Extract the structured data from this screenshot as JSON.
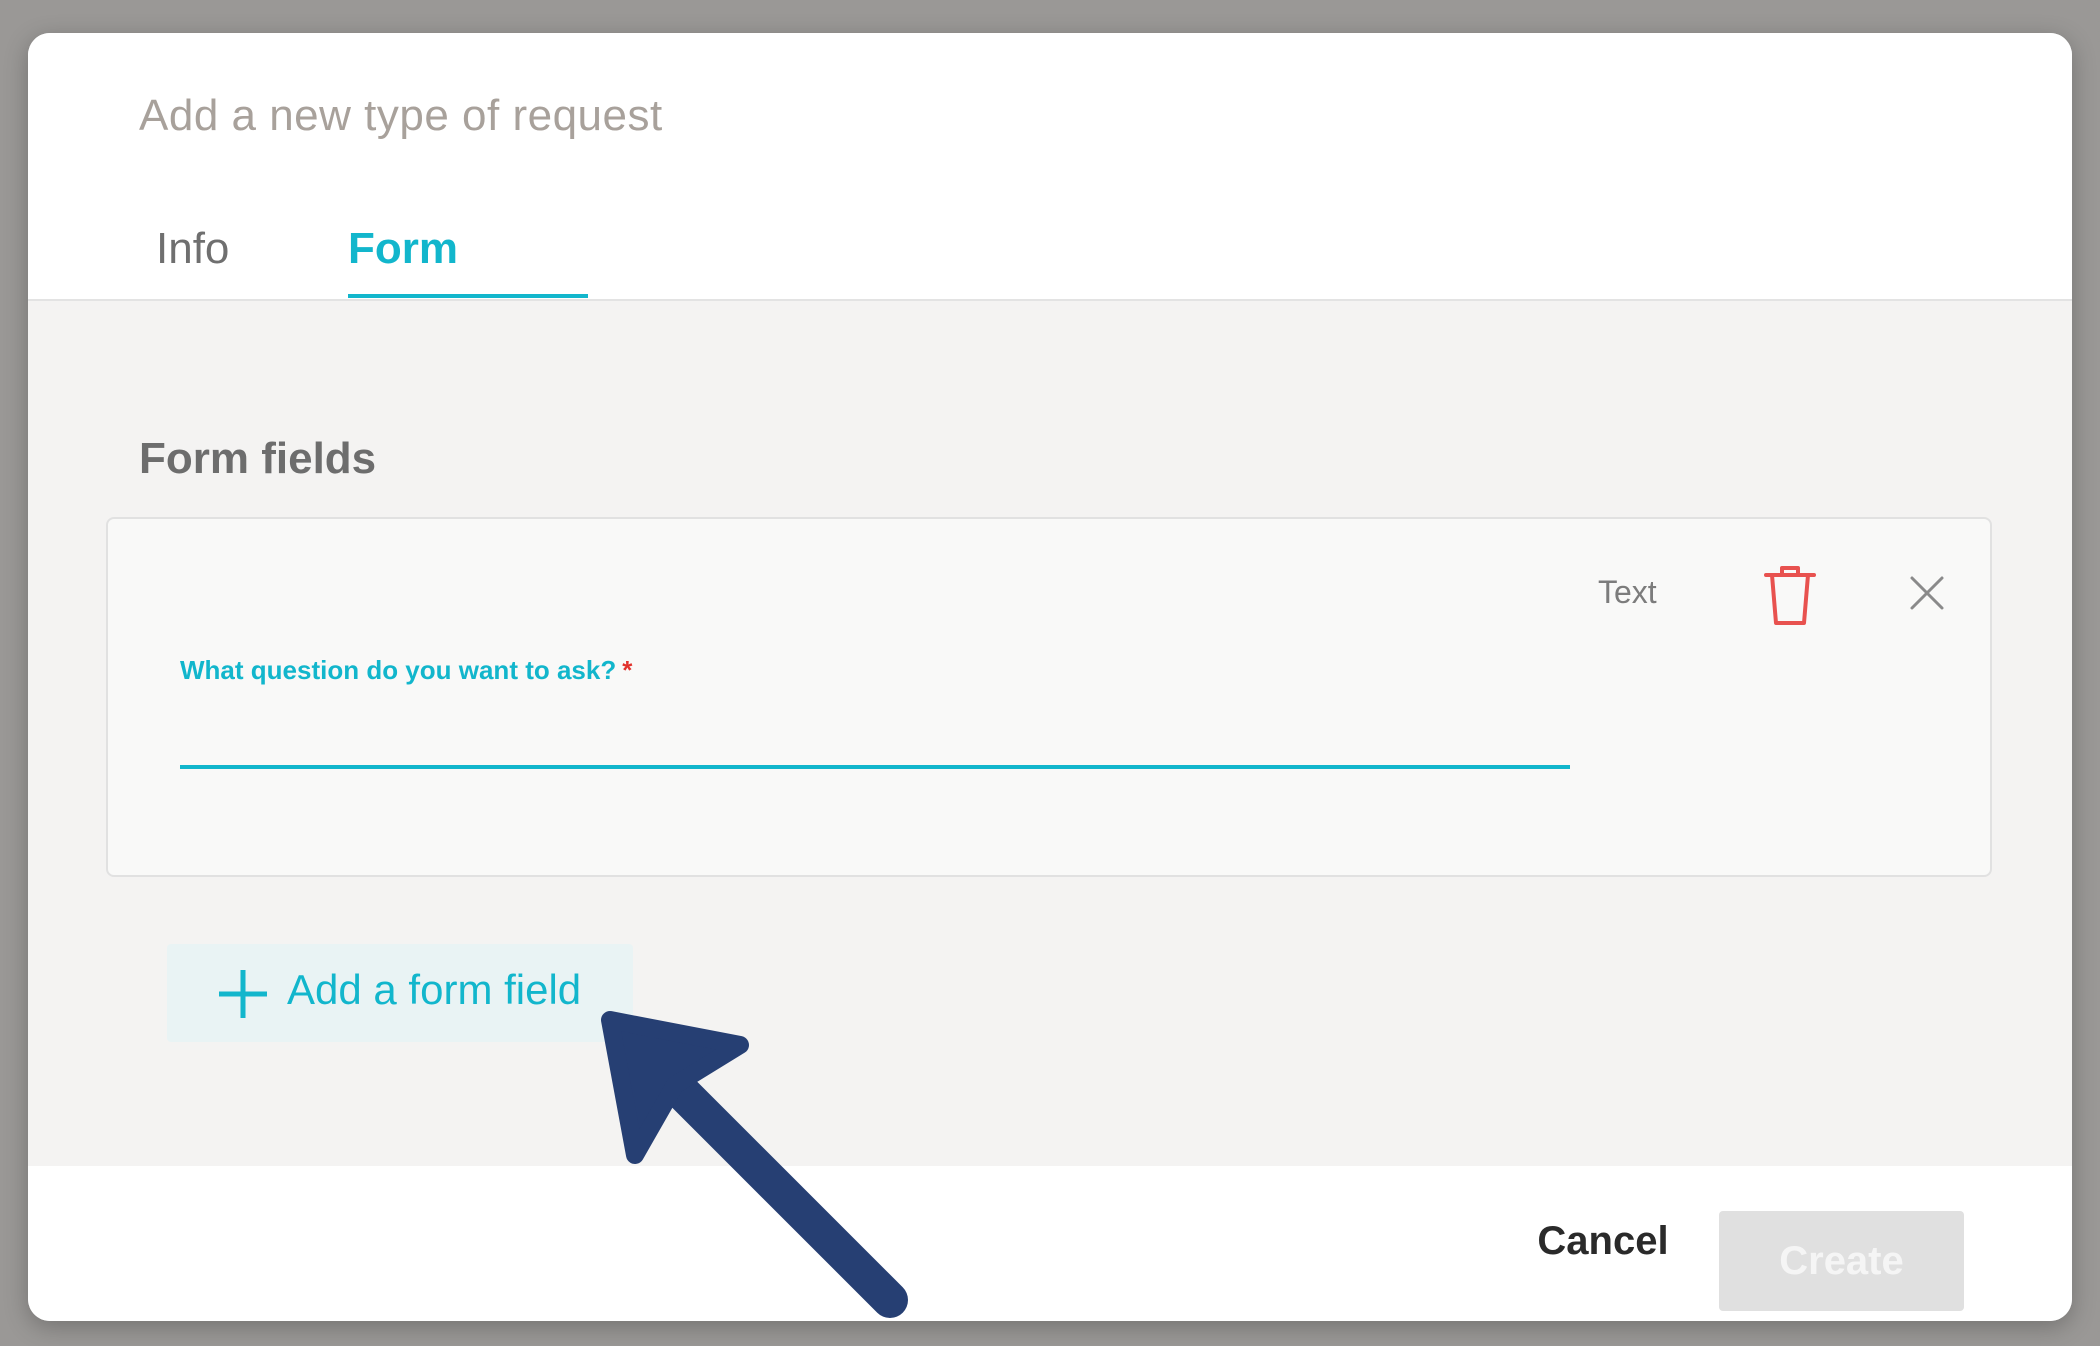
{
  "dialog": {
    "title": "Add a new type of request",
    "tabs": [
      {
        "label": "Info",
        "active": false
      },
      {
        "label": "Form",
        "active": true
      }
    ]
  },
  "form_fields": {
    "section_title": "Form fields",
    "items": [
      {
        "type_label": "Text",
        "question_label": "What question do you want to ask?",
        "required_marker": "*",
        "value": ""
      }
    ],
    "add_button_label": "Add a form field"
  },
  "footer": {
    "cancel_label": "Cancel",
    "create_label": "Create"
  },
  "colors": {
    "accent": "#12b6cc",
    "delete": "#e8524f",
    "annotation_arrow": "#263f73",
    "disabled_button": "#e0e0e0"
  },
  "icons": [
    "trash-icon",
    "close-icon",
    "plus-icon",
    "arrow-annotation-icon"
  ]
}
